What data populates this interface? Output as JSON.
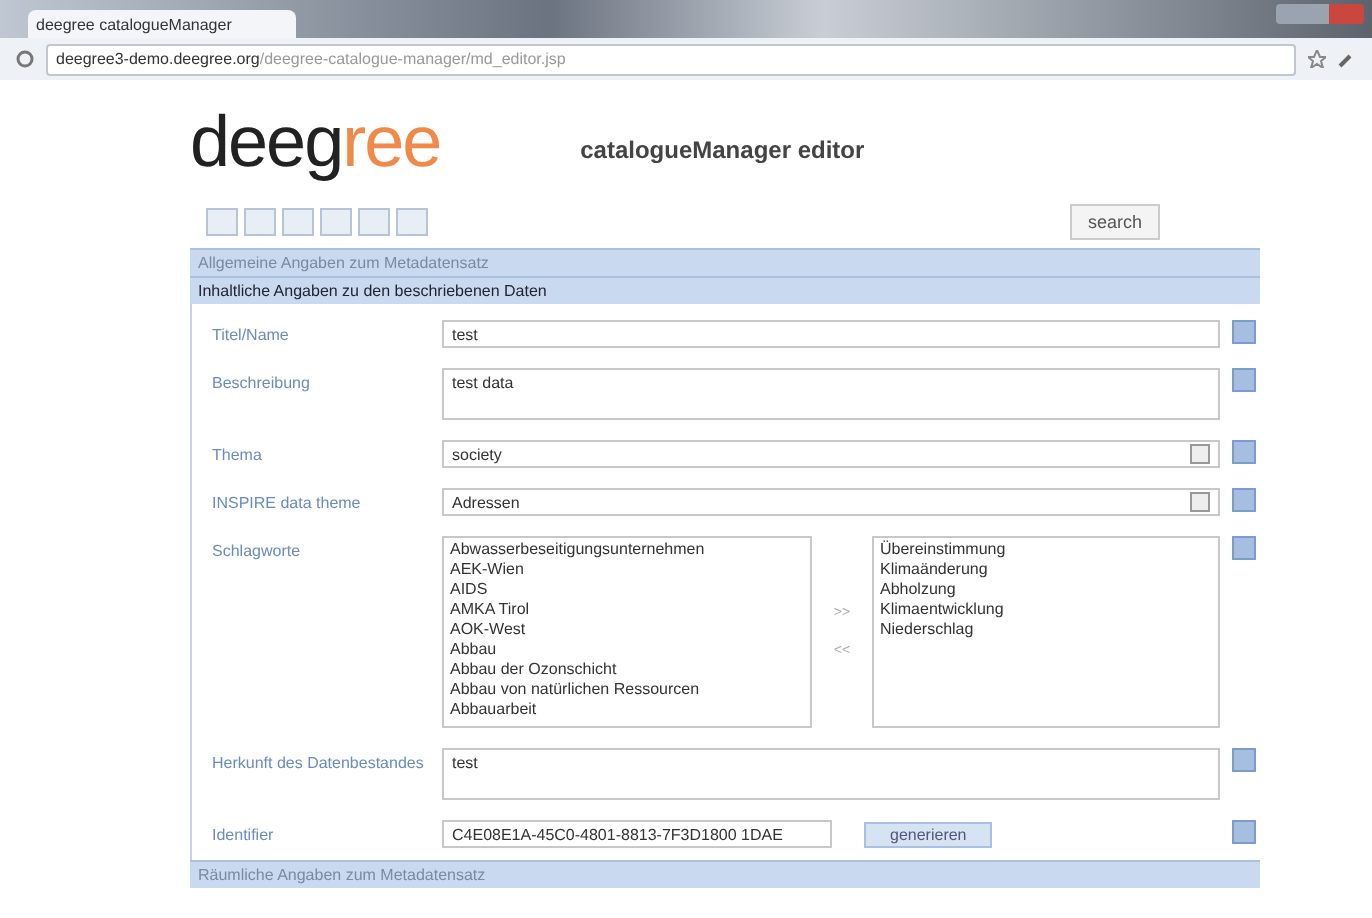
{
  "browser": {
    "tab_title": "deegree catalogueManager",
    "url_host": "deegree3-demo.deegree.org",
    "url_path": "/deegree-catalogue-manager/md_editor.jsp"
  },
  "logo": {
    "dark": "deeg",
    "accent": "ree"
  },
  "title": "catalogueManager editor",
  "toolbar": {
    "search_button": "search"
  },
  "sections": [
    "Allgemeine Angaben zum Metadatensatz",
    "Inhaltliche Angaben zu den beschriebenen Daten"
  ],
  "fields": [
    {
      "kind": "input",
      "label": "Titel/Name",
      "value": "test"
    },
    {
      "kind": "textarea",
      "label": "Beschreibung",
      "value": "test data"
    },
    {
      "kind": "select",
      "label": "Thema",
      "value": "society"
    },
    {
      "kind": "select",
      "label": "INSPIRE data theme",
      "value": "Adressen"
    },
    {
      "kind": "lists",
      "label": "Schlagworte",
      "available": [
        "Abwasserbeseitigungsunternehmen",
        "AEK-Wien",
        "AIDS",
        "AMKA Tirol",
        "AOK-West",
        "Abbau",
        "Abbau der Ozonschicht",
        "Abbau von natürlichen Ressourcen",
        "Abbauarbeit"
      ],
      "add": ">>",
      "remove": "<<",
      "chosen": [
        "Übereinstimmung",
        "Klimaänderung",
        "Abholzung",
        "Klimaentwicklung",
        "Niederschlag"
      ]
    },
    {
      "kind": "textarea",
      "label": "Herkunft des Datenbestandes",
      "value": "test"
    },
    {
      "kind": "identifier",
      "label": "Identifier",
      "value": "C4E08E1A-45C0-4801-8813-7F3D1800 1DAE",
      "button": "generieren"
    }
  ],
  "footer_section": "Räumliche Angaben zum Metadatensatz"
}
